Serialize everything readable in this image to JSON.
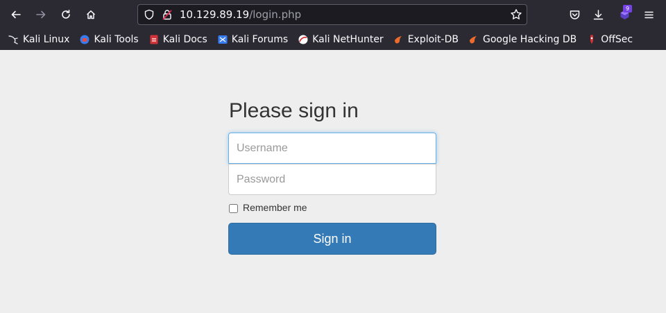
{
  "browser": {
    "url_host": "10.129.89.19",
    "url_path": "/login.php",
    "extension_badge": "9",
    "bookmarks": [
      {
        "label": "Kali Linux",
        "icon": "kali-dragon-icon"
      },
      {
        "label": "Kali Tools",
        "icon": "kali-tools-icon"
      },
      {
        "label": "Kali Docs",
        "icon": "kali-docs-icon"
      },
      {
        "label": "Kali Forums",
        "icon": "kali-forums-icon"
      },
      {
        "label": "Kali NetHunter",
        "icon": "kali-nethunter-icon"
      },
      {
        "label": "Exploit-DB",
        "icon": "exploit-db-icon"
      },
      {
        "label": "Google Hacking DB",
        "icon": "ghdb-icon"
      },
      {
        "label": "OffSec",
        "icon": "offsec-icon"
      }
    ],
    "colors": {
      "toolbar": "#2b2a33",
      "urlbar": "#1c1b22",
      "accent": "#7542e5"
    }
  },
  "login": {
    "heading": "Please sign in",
    "username_placeholder": "Username",
    "password_placeholder": "Password",
    "remember_label": "Remember me",
    "submit_label": "Sign in",
    "colors": {
      "button": "#337ab7",
      "background": "#eeeeee"
    }
  }
}
